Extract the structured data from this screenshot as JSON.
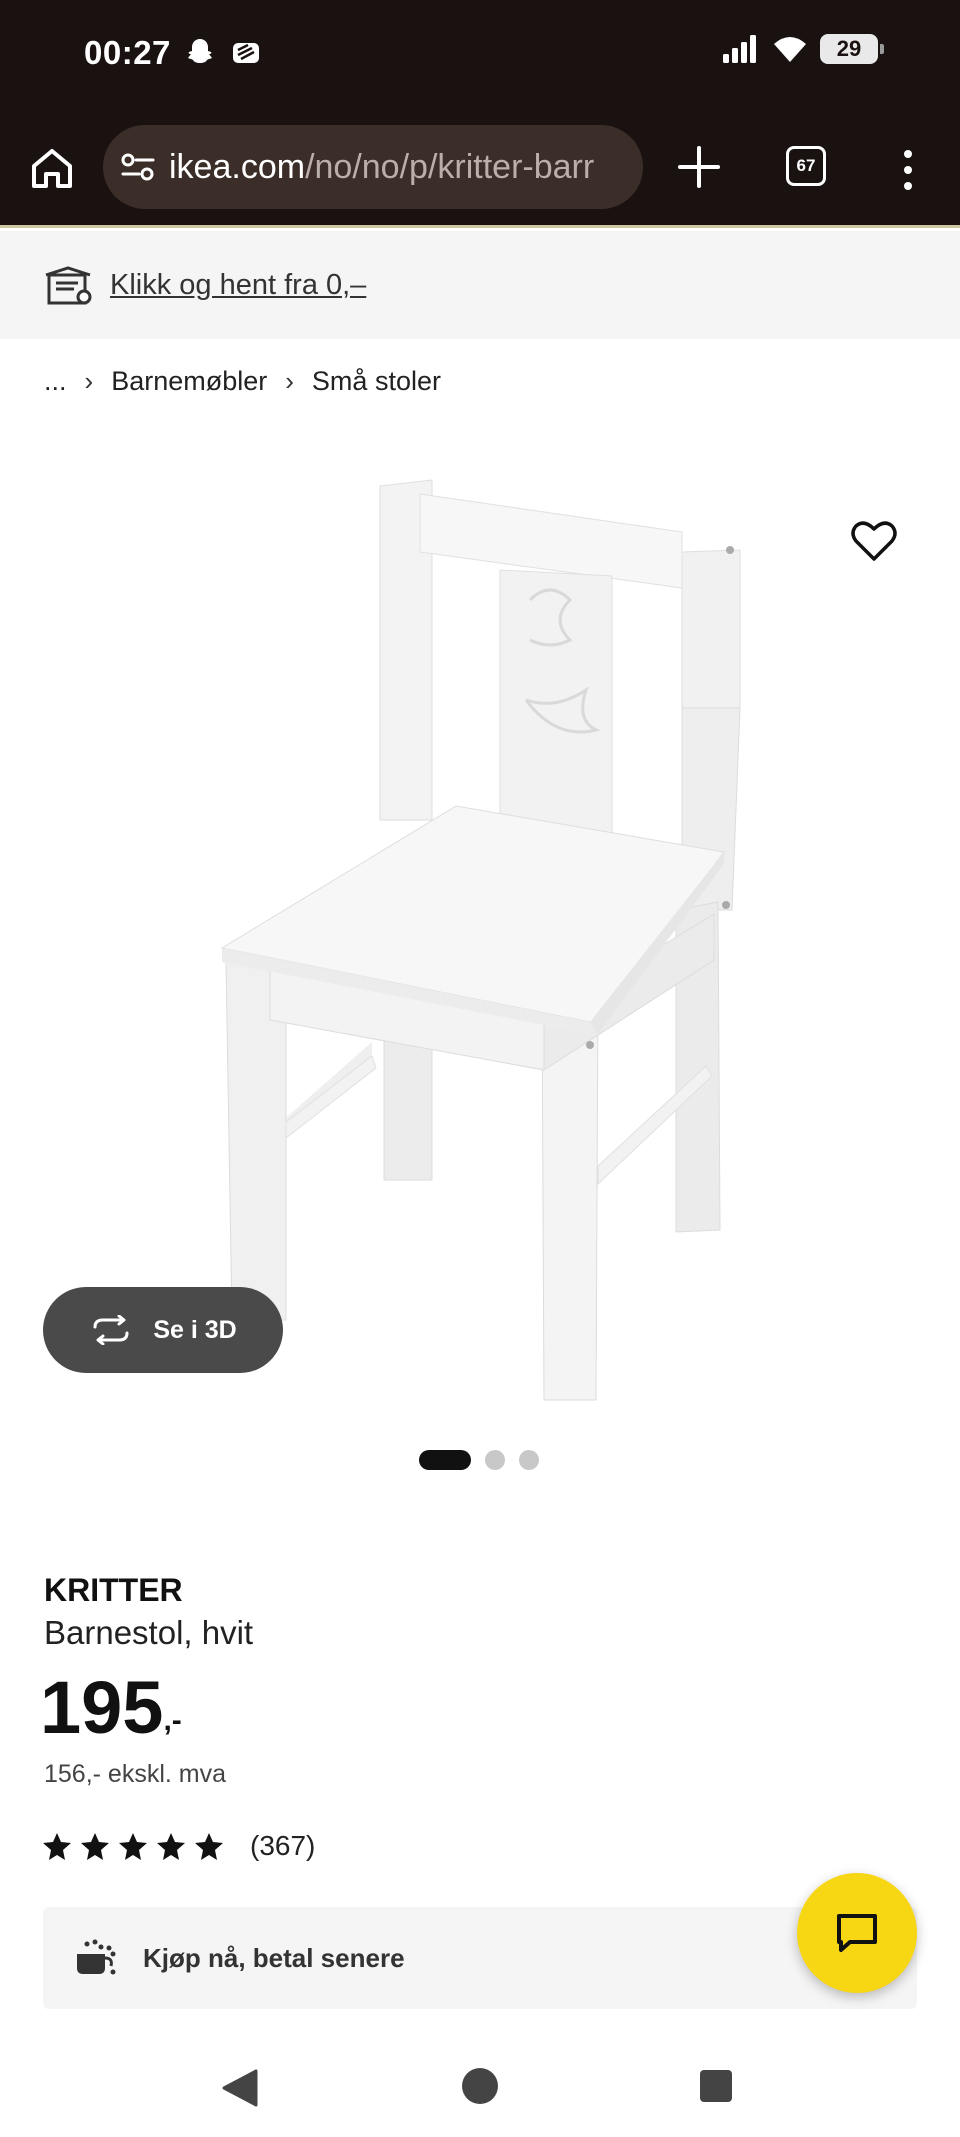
{
  "status_bar": {
    "time": "00:27",
    "battery": "29",
    "icons_left": [
      "snapchat-icon",
      "layers-icon"
    ],
    "icons_right": [
      "signal-icon",
      "wifi-icon",
      "battery-icon"
    ]
  },
  "browser": {
    "url_host": "ikea.com",
    "url_path": "/no/no/p/kritter-barr",
    "tab_count": "67"
  },
  "promo": {
    "text": "Klikk og hent fra 0,–"
  },
  "breadcrumb": {
    "ellipsis": "...",
    "items": [
      "Barnemøbler",
      "Små stoler"
    ]
  },
  "gallery": {
    "btn_3d_label": "Se i 3D",
    "dots_total": 3,
    "dot_active": 1
  },
  "product": {
    "name": "KRITTER",
    "description": "Barnestol, hvit",
    "price_int": "195",
    "price_suffix": ",-",
    "price_ex_vat": "156,- ekskl. mva",
    "rating_stars": 5,
    "review_count": "(367)"
  },
  "paylater": {
    "label": "Kjøp nå, betal senere"
  },
  "colors": {
    "chrome_bg": "#1a1210",
    "chat_yellow": "#f7d614"
  }
}
